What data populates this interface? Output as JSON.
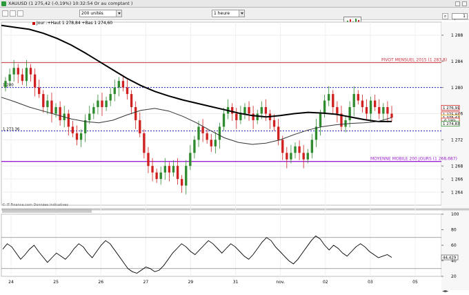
{
  "window": {
    "title": "XAUUSD (1 275,42 (-0,19%) 10:32:54 Or au comptant )"
  },
  "toolbar": {
    "units": "200 unités",
    "period": "1 heure",
    "qty_label": "Qté",
    "qty_value": "1"
  },
  "info_line": "Jour :+Haut 1 278,84 +Bas 1 274,60",
  "source": "© IT-Finance.com Données indicatives",
  "colors": {
    "price_up": "#2e8b2e",
    "price_down": "#d02020",
    "ma200": "#000000",
    "ma_mid": "#333333",
    "pivot": "#c8323c",
    "support_dash": "#2020c0",
    "ma_daily": "#9b1fd0",
    "osc": "#000000"
  },
  "chart_data": [
    {
      "type": "line",
      "ylim": [
        1262,
        1290
      ],
      "yticks": [
        1264,
        1266,
        1268,
        1272,
        1276,
        1280,
        1284,
        1288
      ],
      "x_tick_labels": [
        "24",
        "25",
        "26",
        "27",
        "29",
        "31",
        "nov.",
        "02",
        "03",
        "05"
      ],
      "annotations": [
        {
          "label": "PIVOT MENSUEL 2015 (1 283,8)",
          "value": 1283.8
        },
        {
          "label": "MOYENNE MOBILE 200 JOURS (1 268,687)",
          "value": 1268.687
        },
        {
          "label": "1 280",
          "value": 1280.0
        },
        {
          "label": "1 273.36",
          "value": 1273.36
        }
      ],
      "price_tags": [
        {
          "label": "1 276,91",
          "value": 1276.91
        },
        {
          "label": "1 275,91",
          "value": 1275.91
        },
        {
          "label": "1 275,42",
          "value": 1275.42
        },
        {
          "label": "-0,19%",
          "value": 1274.95
        },
        {
          "label": "1 274,83",
          "value": 1274.45
        }
      ],
      "series": [
        {
          "values": [
            1281,
            1282,
            1283,
            1282,
            1281,
            1283,
            1282,
            1280,
            1279,
            1277,
            1278,
            1276,
            1277,
            1275,
            1276,
            1274,
            1273,
            1272,
            1273,
            1275,
            1276,
            1277,
            1278,
            1277,
            1278,
            1279,
            1280,
            1281,
            1280,
            1279,
            1277,
            1275,
            1273,
            1270,
            1268,
            1267,
            1266,
            1267,
            1268,
            1267,
            1268,
            1266,
            1265,
            1268,
            1270,
            1272,
            1274,
            1273,
            1272,
            1271,
            1272,
            1274,
            1276,
            1277,
            1276,
            1275,
            1276,
            1277,
            1276,
            1275,
            1276,
            1277,
            1276,
            1275,
            1274,
            1272,
            1270,
            1269,
            1270,
            1271,
            1270,
            1269,
            1270,
            1272,
            1274,
            1276,
            1278,
            1279,
            1277,
            1276,
            1274,
            1275,
            1277,
            1279,
            1278,
            1277,
            1276,
            1278,
            1277,
            1276,
            1277,
            1276,
            1275.4
          ]
        },
        {
          "values": [
            1289.5,
            1289.2,
            1288.9,
            1288.3,
            1287.5,
            1286.5,
            1285.3,
            1284.0,
            1282.7,
            1281.4,
            1280.3,
            1279.4,
            1278.7,
            1278.1,
            1277.6,
            1277.1,
            1276.6,
            1276.1,
            1275.7,
            1275.5,
            1275.7,
            1276.0,
            1276.2,
            1276.1,
            1275.9,
            1275.5,
            1275.1,
            1274.8,
            1274.8
          ]
        },
        {
          "values": [
            1278.5,
            1277.8,
            1277.0,
            1276.4,
            1275.8,
            1275.2,
            1274.8,
            1274.6,
            1275.0,
            1275.8,
            1276.5,
            1276.8,
            1276.4,
            1275.6,
            1274.6,
            1273.4,
            1272.3,
            1271.6,
            1271.3,
            1271.5,
            1272.0,
            1272.8,
            1273.5,
            1274.0,
            1274.3,
            1274.5,
            1274.6,
            1274.8,
            1275.4
          ]
        }
      ]
    },
    {
      "type": "line",
      "ylim": [
        20,
        100
      ],
      "yticks": [
        20,
        40,
        60,
        80,
        100
      ],
      "hlines": [
        70,
        30
      ],
      "last_value_label": "44,429",
      "series": [
        {
          "values": [
            55,
            62,
            58,
            50,
            42,
            48,
            55,
            60,
            52,
            45,
            38,
            44,
            50,
            46,
            42,
            48,
            56,
            62,
            58,
            50,
            44,
            52,
            60,
            66,
            62,
            54,
            46,
            38,
            30,
            26,
            24,
            28,
            32,
            30,
            26,
            28,
            34,
            42,
            50,
            56,
            62,
            58,
            52,
            48,
            54,
            60,
            66,
            62,
            56,
            50,
            56,
            62,
            58,
            52,
            46,
            42,
            48,
            56,
            64,
            70,
            66,
            58,
            52,
            46,
            40,
            36,
            42,
            50,
            58,
            66,
            72,
            68,
            60,
            54,
            60,
            56,
            50,
            46,
            52,
            58,
            62,
            58,
            52,
            48,
            44,
            46,
            48,
            44.4
          ]
        }
      ]
    }
  ]
}
